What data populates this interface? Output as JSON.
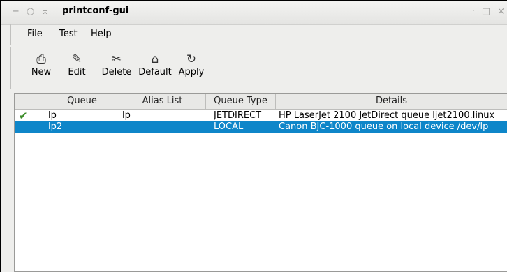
{
  "window": {
    "title": "printconf-gui",
    "title_left_icons": [
      "−",
      "○",
      "⌅"
    ],
    "title_right_icons": [
      "·",
      "□",
      "×"
    ]
  },
  "menu": {
    "file": "File",
    "test": "Test",
    "help": "Help"
  },
  "toolbar": {
    "items": [
      {
        "label": "New",
        "icon": "printer-icon",
        "glyph": "⎙"
      },
      {
        "label": "Edit",
        "icon": "edit-hand-icon",
        "glyph": "✎"
      },
      {
        "label": "Delete",
        "icon": "scissors-icon",
        "glyph": "✂"
      },
      {
        "label": "Default",
        "icon": "home-icon",
        "glyph": "⌂"
      },
      {
        "label": "Apply",
        "icon": "refresh-icon",
        "glyph": "↻"
      }
    ]
  },
  "table": {
    "columns": [
      "",
      "Queue",
      "Alias List",
      "Queue Type",
      "Details"
    ],
    "rows": [
      {
        "default": "✔",
        "queue": "lp",
        "alias": "lp",
        "type": "JETDIRECT",
        "details": "HP LaserJet 2100 JetDirect queue ljet2100.linux",
        "selected": false
      },
      {
        "default": "",
        "queue": "lp2",
        "alias": "",
        "type": "LOCAL",
        "details": "Canon BJC-1000 queue on local device /dev/lp",
        "selected": true
      }
    ]
  },
  "colors": {
    "selection": "#0e86c9",
    "default_check": "#3c8c2a"
  }
}
